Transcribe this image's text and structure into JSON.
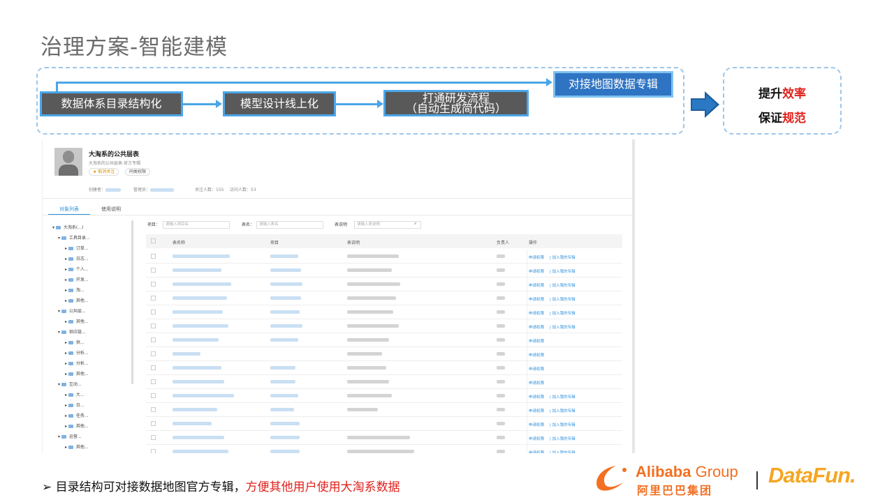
{
  "slide": {
    "title": "治理方案-智能建模"
  },
  "flow": {
    "step1": "数据体系目录结构化",
    "step2": "模型设计线上化",
    "step3_line1": "打通研发流程",
    "step3_line2": "（自动生成简代码）",
    "step4": "对接地图数据专辑"
  },
  "result": {
    "line1_black": "提升",
    "line1_red": "效率",
    "line2_black": "保证",
    "line2_red": "规范"
  },
  "screenshot": {
    "profile_name": "大淘系的公共层表",
    "profile_sub": "大淘系的公共层表-官方专辑",
    "btn_unfollow": "★ 取消关注",
    "btn_share": "同类权限",
    "meta_creator": "创建者：",
    "meta_admin": "管理员：",
    "meta_follow": "关注人数：",
    "meta_follow_count": "155",
    "meta_visit": "访问人数：",
    "meta_visit_count": "53",
    "tab_objects": "对象列表",
    "tab_usage": "使用说明",
    "tree": [
      "大淘系(...)",
      "工具目录...",
      "订单...",
      "日志...",
      "个人...",
      "开发...",
      "淘...",
      "其他...",
      "公共层...",
      "其他...",
      "供应链...",
      "供...",
      "分析...",
      "分析...",
      "其他...",
      "互动...",
      "大...",
      "日...",
      "任务...",
      "其他...",
      "运营...",
      "其他..."
    ],
    "filter_project": "项目：",
    "filter_project_ph": "请输入项目名",
    "filter_table": "表名：",
    "filter_table_ph": "请输入表名",
    "filter_desc": "表说明",
    "filter_desc_ph": "请输入表说明",
    "col_table": "表名称",
    "col_project": "项目",
    "col_desc": "表说明",
    "col_owner": "负责人",
    "col_action": "操作",
    "action_apply": "申请权限",
    "action_add": "加入我的专辑"
  },
  "bullet": {
    "main": "目录结构可对接数据地图官方专辑，",
    "highlight": "方便其他用户使用大淘系数据"
  },
  "logos": {
    "alibaba_en_bold": "Alibaba",
    "alibaba_en_light": " Group",
    "alibaba_cn": "阿里巴巴集团",
    "datafun": "DataFun."
  },
  "colors": {
    "flow_border": "#4aa6e8",
    "flow_box": "#595959",
    "flow_highlight": "#2e74c2",
    "accent_red": "#e0201b",
    "alibaba_orange": "#f36f21"
  }
}
